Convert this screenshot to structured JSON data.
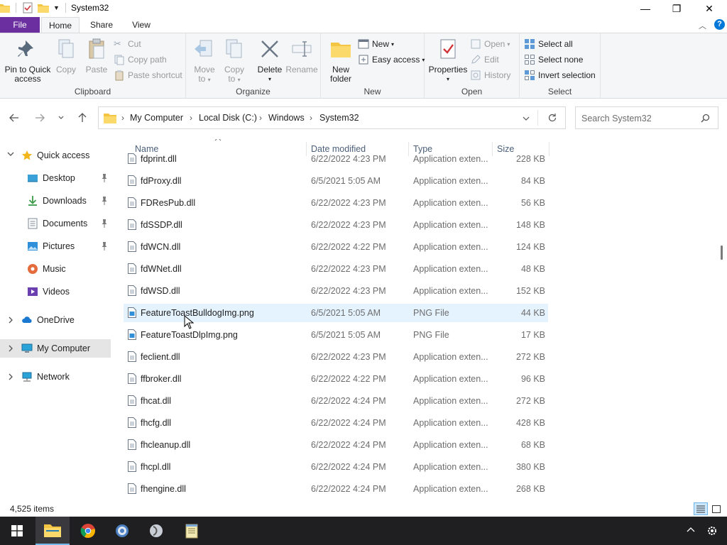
{
  "window": {
    "title": "System32",
    "minimize_glyph": "—",
    "maximize_glyph": "❐",
    "close_glyph": "✕"
  },
  "ribbon_tabs": {
    "file": "File",
    "home": "Home",
    "share": "Share",
    "view": "View"
  },
  "ribbon": {
    "clipboard": {
      "label": "Clipboard",
      "pin_label_1": "Pin to Quick",
      "pin_label_2": "access",
      "copy": "Copy",
      "paste": "Paste",
      "cut": "Cut",
      "copy_path": "Copy path",
      "paste_shortcut": "Paste shortcut"
    },
    "organize": {
      "label": "Organize",
      "move_to_1": "Move",
      "move_to_2": "to",
      "copy_to_1": "Copy",
      "copy_to_2": "to",
      "delete": "Delete",
      "rename": "Rename"
    },
    "new": {
      "label": "New",
      "new_folder_1": "New",
      "new_folder_2": "folder",
      "new_item": "New",
      "easy_access": "Easy access"
    },
    "open": {
      "label": "Open",
      "properties": "Properties",
      "open": "Open",
      "edit": "Edit",
      "history": "History"
    },
    "select": {
      "label": "Select",
      "select_all": "Select all",
      "select_none": "Select none",
      "invert_selection": "Invert selection"
    }
  },
  "address": {
    "crumbs": [
      "My Computer",
      "Local Disk (C:)",
      "Windows",
      "System32"
    ]
  },
  "search": {
    "placeholder": "Search System32"
  },
  "nav": {
    "quick_access": "Quick access",
    "desktop": "Desktop",
    "downloads": "Downloads",
    "documents": "Documents",
    "pictures": "Pictures",
    "music": "Music",
    "videos": "Videos",
    "onedrive": "OneDrive",
    "my_computer": "My Computer",
    "network": "Network"
  },
  "columns": {
    "name": "Name",
    "date": "Date modified",
    "type": "Type",
    "size": "Size"
  },
  "files": [
    {
      "name": "fdprint.dll",
      "date": "6/22/2022 4:23 PM",
      "type": "Application exten...",
      "size": "228 KB",
      "icon": "dll-file-icon"
    },
    {
      "name": "fdProxy.dll",
      "date": "6/5/2021 5:05 AM",
      "type": "Application exten...",
      "size": "84 KB",
      "icon": "dll-file-icon"
    },
    {
      "name": "FDResPub.dll",
      "date": "6/22/2022 4:23 PM",
      "type": "Application exten...",
      "size": "56 KB",
      "icon": "dll-file-icon"
    },
    {
      "name": "fdSSDP.dll",
      "date": "6/22/2022 4:23 PM",
      "type": "Application exten...",
      "size": "148 KB",
      "icon": "dll-file-icon"
    },
    {
      "name": "fdWCN.dll",
      "date": "6/22/2022 4:22 PM",
      "type": "Application exten...",
      "size": "124 KB",
      "icon": "dll-file-icon"
    },
    {
      "name": "fdWNet.dll",
      "date": "6/22/2022 4:23 PM",
      "type": "Application exten...",
      "size": "48 KB",
      "icon": "dll-file-icon"
    },
    {
      "name": "fdWSD.dll",
      "date": "6/22/2022 4:23 PM",
      "type": "Application exten...",
      "size": "152 KB",
      "icon": "dll-file-icon"
    },
    {
      "name": "FeatureToastBulldogImg.png",
      "date": "6/5/2021 5:05 AM",
      "type": "PNG File",
      "size": "44 KB",
      "icon": "png-file-icon"
    },
    {
      "name": "FeatureToastDlpImg.png",
      "date": "6/5/2021 5:05 AM",
      "type": "PNG File",
      "size": "17 KB",
      "icon": "png-file-icon"
    },
    {
      "name": "feclient.dll",
      "date": "6/22/2022 4:23 PM",
      "type": "Application exten...",
      "size": "272 KB",
      "icon": "dll-file-icon"
    },
    {
      "name": "ffbroker.dll",
      "date": "6/22/2022 4:22 PM",
      "type": "Application exten...",
      "size": "96 KB",
      "icon": "dll-file-icon"
    },
    {
      "name": "fhcat.dll",
      "date": "6/22/2022 4:24 PM",
      "type": "Application exten...",
      "size": "272 KB",
      "icon": "dll-file-icon"
    },
    {
      "name": "fhcfg.dll",
      "date": "6/22/2022 4:24 PM",
      "type": "Application exten...",
      "size": "428 KB",
      "icon": "dll-file-icon"
    },
    {
      "name": "fhcleanup.dll",
      "date": "6/22/2022 4:24 PM",
      "type": "Application exten...",
      "size": "68 KB",
      "icon": "dll-file-icon"
    },
    {
      "name": "fhcpl.dll",
      "date": "6/22/2022 4:24 PM",
      "type": "Application exten...",
      "size": "380 KB",
      "icon": "dll-file-icon"
    },
    {
      "name": "fhengine.dll",
      "date": "6/22/2022 4:24 PM",
      "type": "Application exten...",
      "size": "268 KB",
      "icon": "dll-file-icon"
    }
  ],
  "hovered_row": 7,
  "status": {
    "item_count": "4,525 items"
  },
  "colors": {
    "file_tab": "#6b2fa0",
    "hover_row": "#e5f3ff",
    "selected_nav": "#e5e5e5",
    "taskbar": "#1f1f22",
    "folder_yellow": "#f4c542",
    "accent_blue": "#0078d7"
  }
}
